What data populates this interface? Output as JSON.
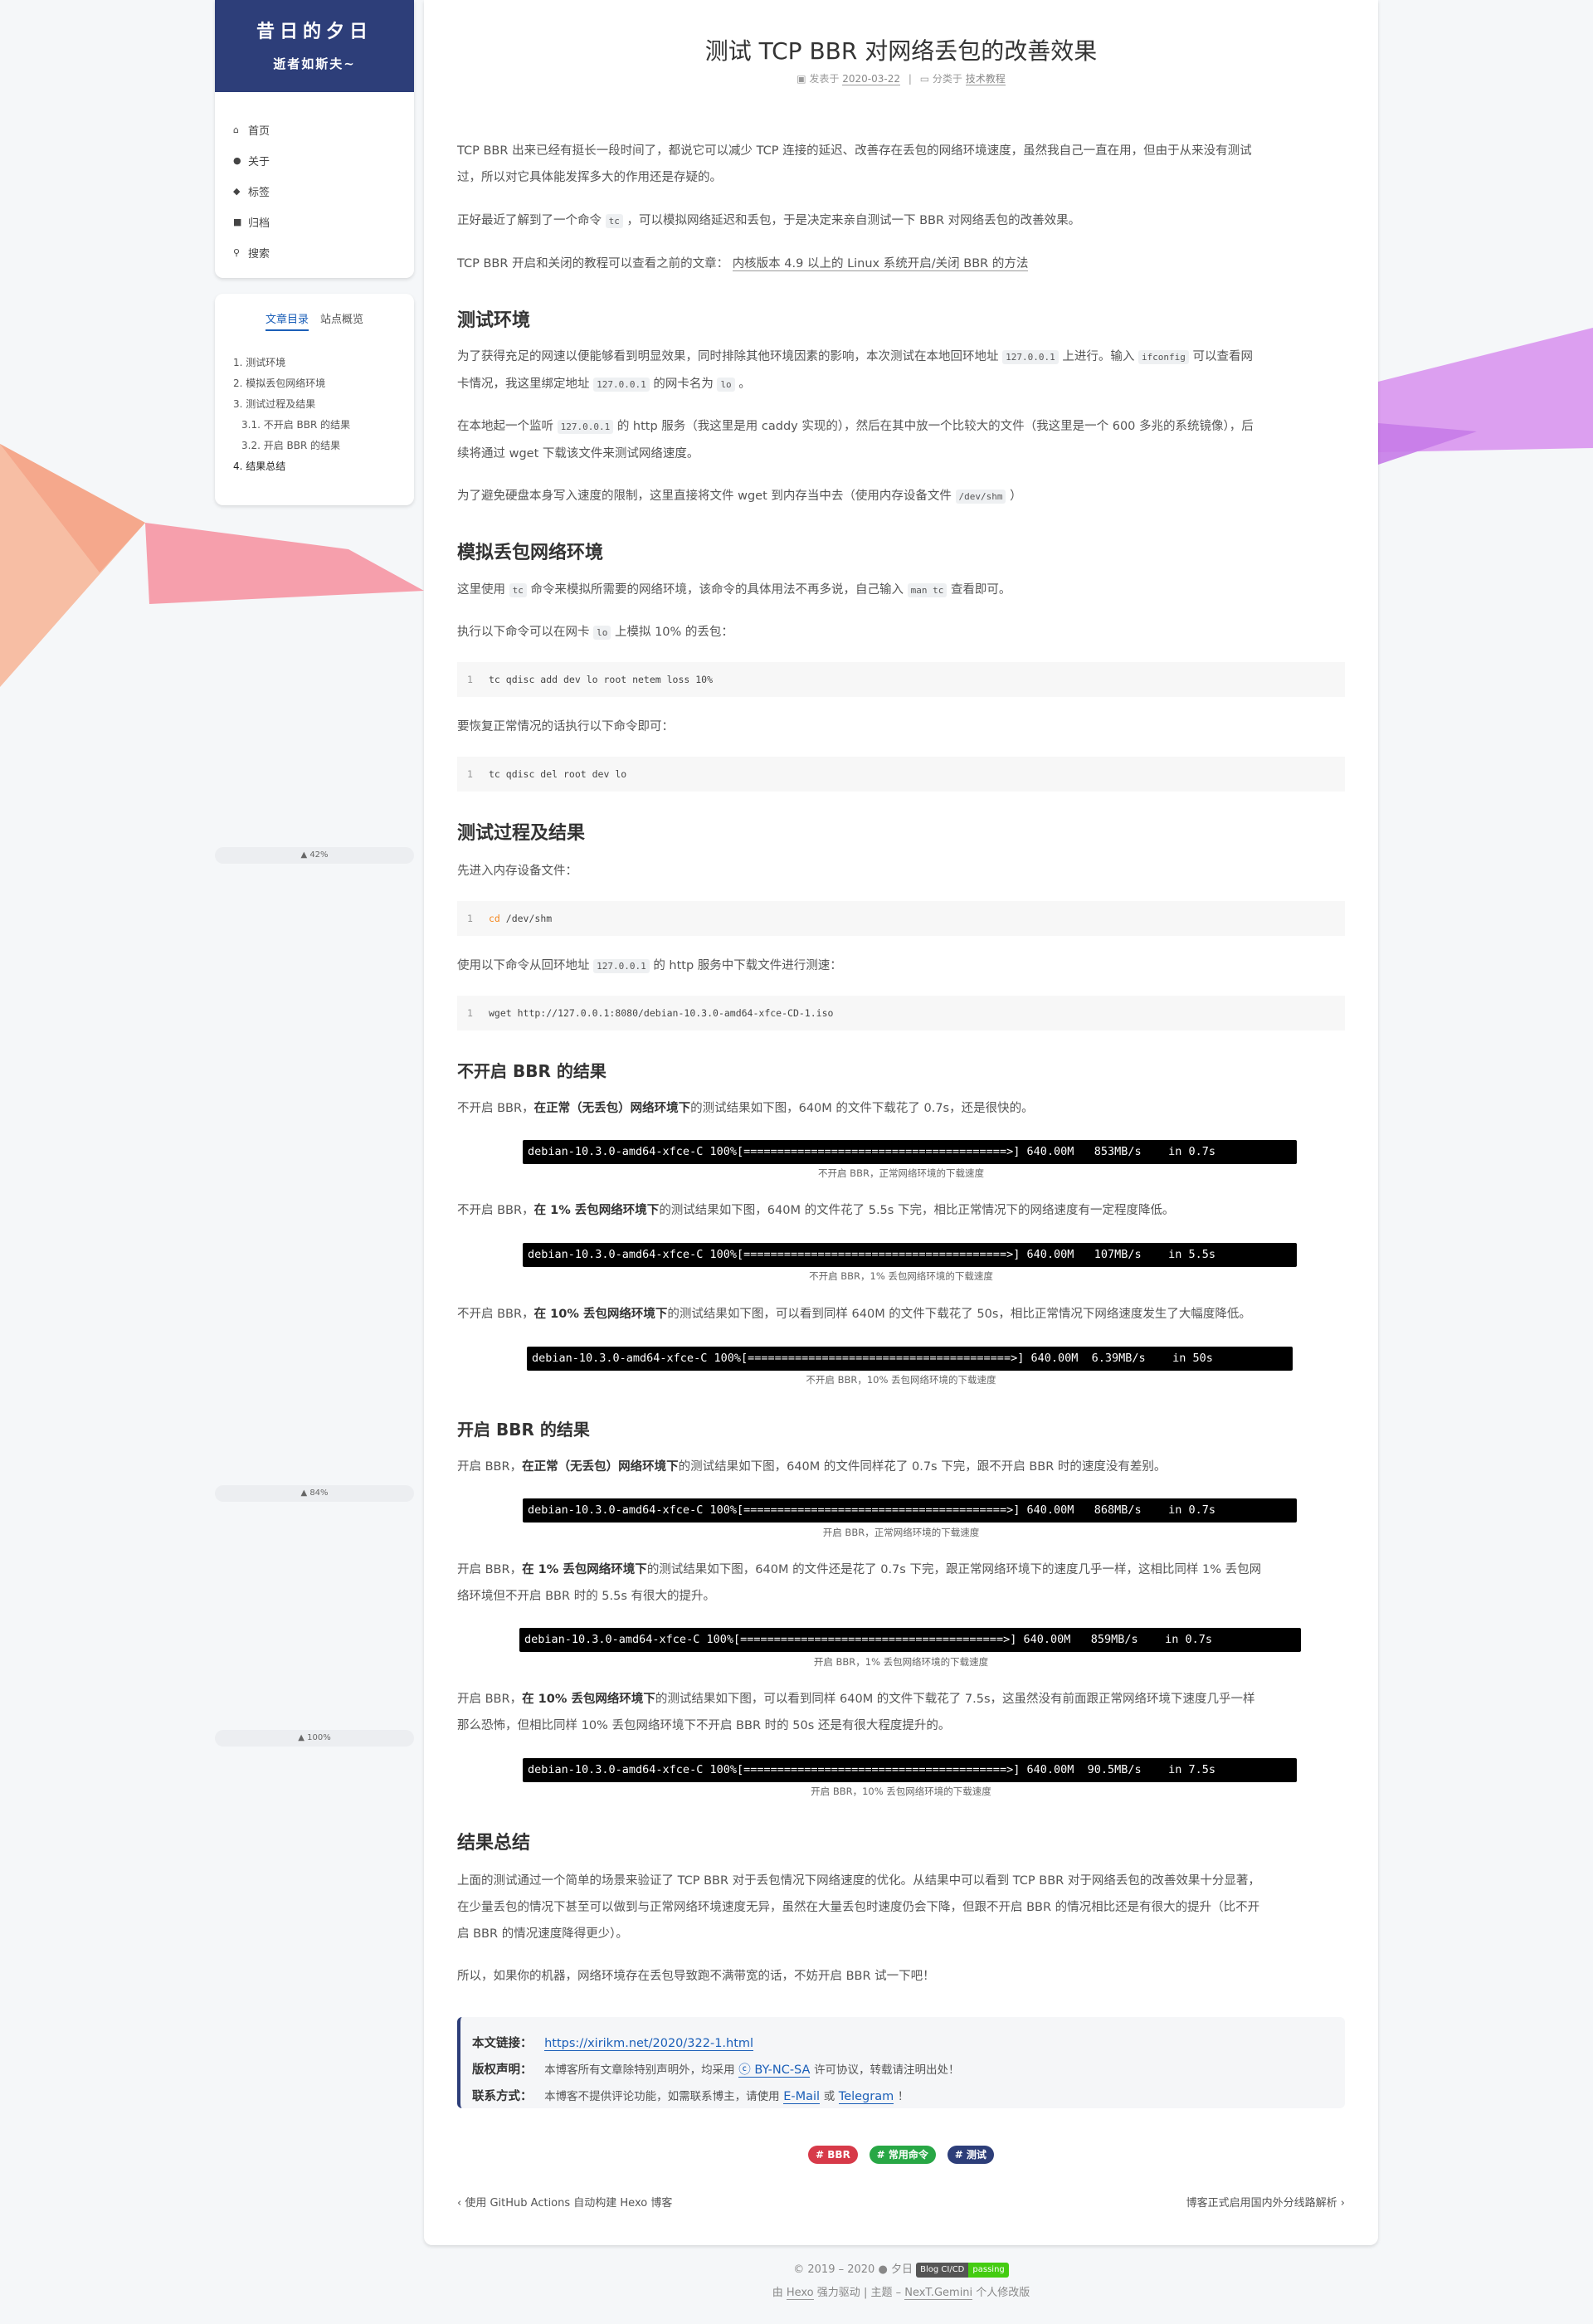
{
  "sidebar": {
    "site_title": "昔日的夕日",
    "site_subtitle": "逝者如斯夫~",
    "menu": [
      {
        "icon": "home-icon",
        "label": "首页"
      },
      {
        "icon": "user-icon",
        "label": "关于"
      },
      {
        "icon": "tags-icon",
        "label": "标签"
      },
      {
        "icon": "archive-icon",
        "label": "归档"
      },
      {
        "icon": "search-icon",
        "label": "搜索"
      }
    ],
    "toc_tab_active": "文章目录",
    "toc_tab_other": "站点概览",
    "toc": [
      "1. 测试环境",
      "2. 模拟丢包网络环境",
      "3. 测试过程及结果",
      "3.1. 不开启 BBR 的结果",
      "3.2. 开启 BBR 的结果",
      "4. 结果总结"
    ],
    "progress": [
      "42%",
      "84%",
      "100%"
    ]
  },
  "post": {
    "title": "测试 TCP BBR 对网络丢包的改善效果",
    "meta_published_label": "发表于",
    "meta_date": "2020-03-22",
    "meta_category_label": "分类于",
    "meta_category": "技术教程",
    "p1": "TCP BBR 出来已经有挺长一段时间了，都说它可以减少 TCP 连接的延迟、改善存在丢包的网络环境速度，虽然我自己一直在用，但由于从来没有测试",
    "p1b": "过，所以对它具体能发挥多大的作用还是存疑的。",
    "p2a": "正好最近了解到了一个命令",
    "p2_code": "tc",
    "p2b": "，可以模拟网络延迟和丢包，于是决定来亲自测试一下 BBR 对网络丢包的改善效果。",
    "p3a": "TCP BBR 开启和关闭的教程可以查看之前的文章：",
    "p3_link": "内核版本 4.9 以上的 Linux 系统开启/关闭 BBR 的方法",
    "h_env": "测试环境",
    "env1a": "为了获得充足的网速以便能够看到明显效果，同时排除其他环境因素的影响，本次测试在本地回环地址",
    "env1_code1": "127.0.0.1",
    "env1b": "上进行。输入",
    "env1_code2": "ifconfig",
    "env1c": "可以查看网",
    "env1d": "卡情况，我这里绑定地址",
    "env1_code3": "127.0.0.1",
    "env1e": "的网卡名为",
    "env1_code4": "lo",
    "env1f": "。",
    "env2a": "在本地起一个监听",
    "env2_code": "127.0.0.1",
    "env2b": "的 http 服务（我这里是用 caddy 实现的），然后在其中放一个比较大的文件（我这里是一个 600 多兆的系统镜像），后",
    "env2c": "续将通过 wget 下载该文件来测试网络速度。",
    "env3a": "为了避免硬盘本身写入速度的限制，这里直接将文件 wget 到内存当中去（使用内存设备文件",
    "env3_code": "/dev/shm",
    "env3b": "）",
    "h_sim": "模拟丢包网络环境",
    "sim1a": "这里使用",
    "sim1_code1": "tc",
    "sim1b": "命令来模拟所需要的网络环境，该命令的具体用法不再多说，自己输入",
    "sim1_code2": "man tc",
    "sim1c": "查看即可。",
    "sim2a": "执行以下命令可以在网卡",
    "sim2_code": "lo",
    "sim2b": "上模拟 10% 的丢包：",
    "code1": "tc qdisc add dev lo root netem loss 10%",
    "sim3": "要恢复正常情况的话执行以下命令即可：",
    "code2": "tc qdisc del root dev lo",
    "h_proc": "测试过程及结果",
    "proc1": "先进入内存设备文件：",
    "code3_kw": "cd",
    "code3_rest": " /dev/shm",
    "proc2a": "使用以下命令从回环地址",
    "proc2_code": "127.0.0.1",
    "proc2b": "的 http 服务中下载文件进行测速：",
    "code4": "wget http://127.0.0.1:8080/debian-10.3.0-amd64-xfce-CD-1.iso",
    "code_ln": "1",
    "h_nobbr": "不开启 BBR 的结果",
    "nb1a": "不开启 BBR，",
    "nb1b": "在正常（无丢包）网络环境下",
    "nb1c": "的测试结果如下图，640M 的文件下载花了 0.7s，还是很快的。",
    "term1": "debian-10.3.0-amd64-xfce-C 100%[=======================================>] 640.00M   853MB/s    in 0.7s",
    "cap1": "不开启 BBR，正常网络环境的下载速度",
    "nb2a": "不开启 BBR，",
    "nb2b": "在 1% 丢包网络环境下",
    "nb2c": "的测试结果如下图，640M 的文件花了 5.5s 下完，相比正常情况下的网络速度有一定程度降低。",
    "term2": "debian-10.3.0-amd64-xfce-C 100%[=======================================>] 640.00M   107MB/s    in 5.5s",
    "cap2": "不开启 BBR，1% 丢包网络环境的下载速度",
    "nb3a": "不开启 BBR，",
    "nb3b": "在 10% 丢包网络环境下",
    "nb3c": "的测试结果如下图，可以看到同样 640M 的文件下载花了 50s，相比正常情况下网络速度发生了大幅度降低。",
    "term3": "debian-10.3.0-amd64-xfce-C 100%[=======================================>] 640.00M  6.39MB/s    in 50s",
    "cap3": "不开启 BBR，10% 丢包网络环境的下载速度",
    "h_bbr": "开启 BBR 的结果",
    "b1a": "开启 BBR，",
    "b1b": "在正常（无丢包）网络环境下",
    "b1c": "的测试结果如下图，640M 的文件同样花了 0.7s 下完，跟不开启 BBR 时的速度没有差别。",
    "term4": "debian-10.3.0-amd64-xfce-C 100%[=======================================>] 640.00M   868MB/s    in 0.7s",
    "cap4": "开启 BBR，正常网络环境的下载速度",
    "b2a": "开启 BBR，",
    "b2b": "在 1% 丢包网络环境下",
    "b2c": "的测试结果如下图，640M 的文件还是花了 0.7s 下完，跟正常网络环境下的速度几乎一样，这相比同样 1% 丢包网",
    "b2d": "络环境但不开启 BBR 时的 5.5s 有很大的提升。",
    "term5": "debian-10.3.0-amd64-xfce-C 100%[=======================================>] 640.00M   859MB/s    in 0.7s",
    "cap5": "开启 BBR，1% 丢包网络环境的下载速度",
    "b3a": "开启 BBR，",
    "b3b": "在 10% 丢包网络环境下",
    "b3c": "的测试结果如下图，可以看到同样 640M 的文件下载花了 7.5s，这虽然没有前面跟正常网络环境下速度几乎一样",
    "b3d": "那么恐怖，但相比同样 10% 丢包网络环境下不开启 BBR 时的 50s 还是有很大程度提升的。",
    "term6": "debian-10.3.0-amd64-xfce-C 100%[=======================================>] 640.00M  90.5MB/s    in 7.5s",
    "cap6": "开启 BBR，10% 丢包网络环境的下载速度",
    "h_sum": "结果总结",
    "s1a": "上面的测试通过一个简单的场景来验证了 TCP BBR 对于丢包情况下网络速度的优化。从结果中可以看到 TCP BBR 对于网络丢包的改善效果十分显著，",
    "s1b": "在少量丢包的情况下甚至可以做到与正常网络环境速度无异，虽然在大量丢包时速度仍会下降，但跟不开启 BBR 的情况相比还是有很大的提升（比不开",
    "s1c": "启 BBR 的情况速度降得更少）。",
    "s2": "所以，如果你的机器，网络环境存在丢包导致跑不满带宽的话，不妨开启 BBR 试一下吧！",
    "cr_link_label": "本文链接：",
    "cr_link": "https://xirikm.net/2020/322-1.html",
    "cr_lic_label": "版权声明：",
    "cr_lic_a": "本博客所有文章除特别声明外，均采用",
    "cr_lic_link": "BY-NC-SA",
    "cr_lic_b": "许可协议，转载请注明出处！",
    "cr_contact_label": "联系方式：",
    "cr_contact_a": "本博客不提供评论功能，如需联系博主，请使用",
    "cr_contact_email": "E-Mail",
    "cr_contact_or": "或",
    "cr_contact_tg": "Telegram",
    "cr_contact_end": "！",
    "tags": [
      {
        "label": "# BBR",
        "color": "#d73a49"
      },
      {
        "label": "# 常用命令",
        "color": "#28a745"
      },
      {
        "label": "# 测试",
        "color": "#2d3e79"
      }
    ],
    "prev": "使用 GitHub Actions 自动构建 Hexo 博客",
    "next": "博客正式启用国内外分线路解析"
  },
  "footer": {
    "copy": "© 2019 – 2020",
    "author": "夕日",
    "badge_left": "Blog CI/CD",
    "badge_right": "passing",
    "powered_a": "由",
    "powered_hexo": "Hexo",
    "powered_b": "强力驱动",
    "theme_a": "主题 –",
    "theme_link": "NexT.Gemini",
    "theme_b": "个人修改版"
  },
  "colors": {
    "brand": "#2d3e79",
    "link": "#1b5fb8",
    "badge_pass": "#44cc11"
  }
}
